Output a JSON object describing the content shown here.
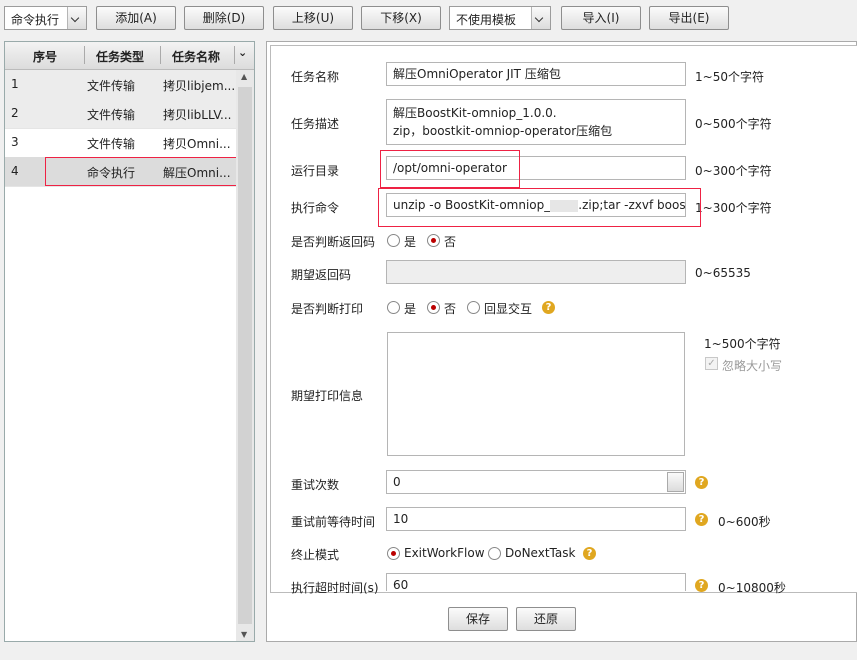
{
  "toolbar": {
    "mode_select": "命令执行",
    "add": "添加(A)",
    "delete": "删除(D)",
    "up": "上移(U)",
    "down": "下移(X)",
    "template_select": "不使用模板",
    "import": "导入(I)",
    "export": "导出(E)"
  },
  "table": {
    "columns": [
      "序号",
      "任务类型",
      "任务名称"
    ],
    "rows": [
      {
        "no": "1",
        "type": "文件传输",
        "name": "拷贝libjem..."
      },
      {
        "no": "2",
        "type": "文件传输",
        "name": "拷贝libLLV..."
      },
      {
        "no": "3",
        "type": "文件传输",
        "name": "拷贝Omni..."
      },
      {
        "no": "4",
        "type": "命令执行",
        "name": "解压Omni..."
      }
    ]
  },
  "form": {
    "task_name_label": "任务名称",
    "task_name_value": "解压OmniOperator JIT 压缩包",
    "task_name_hint": "1~50个字符",
    "task_desc_label": "任务描述",
    "task_desc_line1": "解压BoostKit-omniop_1.0.0.",
    "task_desc_line2": "zip，boostkit-omniop-operator压缩包",
    "task_desc_hint": "0~500个字符",
    "run_dir_label": "运行目录",
    "run_dir_value": "/opt/omni-operator",
    "run_dir_hint": "0~300个字符",
    "cmd_label": "执行命令",
    "cmd_value_a": "unzip -o BoostKit-omniop_",
    "cmd_value_b": ".zip;tar -zxvf boostkit-om",
    "cmd_hint": "1~300个字符",
    "check_rc_label": "是否判断返回码",
    "yes": "是",
    "no": "否",
    "expected_rc_label": "期望返回码",
    "expected_rc_hint": "0~65535",
    "check_print_label": "是否判断打印",
    "echo_interact": "回显交互",
    "expected_print_label": "期望打印信息",
    "expected_print_hint": "1~500个字符",
    "ignore_case": "忽略大小写",
    "retry_label": "重试次数",
    "retry_value": "0",
    "retry_wait_label": "重试前等待时间",
    "retry_wait_value": "10",
    "retry_wait_hint": "0~600秒",
    "stop_mode_label": "终止模式",
    "exit_wf": "ExitWorkFlow",
    "do_next": "DoNextTask",
    "timeout_label": "执行超时时间(s)",
    "timeout_value": "60",
    "timeout_hint": "0~10800秒"
  },
  "footer": {
    "save": "保存",
    "restore": "还原"
  },
  "colors": {
    "accent_red": "#e24040",
    "radio_dot": "#b00000",
    "help": "#e0a720"
  }
}
